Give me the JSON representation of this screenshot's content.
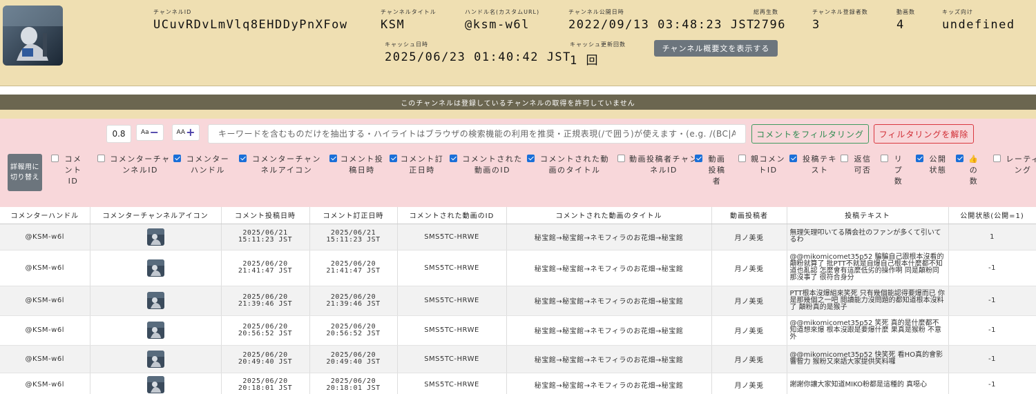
{
  "channel": {
    "avatar_icon": "channel-avatar-icon",
    "id_label": "チャンネルID",
    "id_value": "UCuvRDvLmVlq8EHDDyPnXFow",
    "title_label": "チャンネルタイトル",
    "title_value": "KSM",
    "handle_label": "ハンドル名(カスタムURL)",
    "handle_value": "@ksm-w6l",
    "published_label": "チャンネル公開日時",
    "published_value": "2022/09/13 03:48:23 JST",
    "views_label": "総再生数",
    "views_value": "2796",
    "subs_label": "チャンネル登録者数",
    "subs_value": "3",
    "videos_label": "動画数",
    "videos_value": "4",
    "kids_label": "キッズ向け",
    "kids_value": "undefined",
    "cache_label": "キャッシュ日時",
    "cache_value": "2025/06/23 01:40:42 JST",
    "cache_updates_label": "キャッシュ更新回数",
    "cache_updates_value": "1 回",
    "show_desc_button": "チャンネル概要文を表示する"
  },
  "notice": "このチャンネルは登録しているチャンネルの取得を許可していません",
  "filter": {
    "font_scale": "0.8",
    "decrease_label": "Aa",
    "increase_label": "AA",
    "search_placeholder": "キーワードを含むものだけを抽出する・ハイライトはブラウザの検索機能の利用を推奨・正規表現(/で囲う)が使えます・(e.g. /(BC|AC",
    "filter_button": "コメントをフィルタリング",
    "clear_button": "フィルタリングを解除",
    "switch_button": "詳報用に切り替え"
  },
  "columns": [
    {
      "label": "コメントID",
      "checked": false
    },
    {
      "label": "コメンターチャンネルID",
      "checked": false
    },
    {
      "label": "コメンターハンドル",
      "checked": true
    },
    {
      "label": "コメンターチャンネルアイコン",
      "checked": true
    },
    {
      "label": "コメント投稿日時",
      "checked": true
    },
    {
      "label": "コメント訂正日時",
      "checked": true
    },
    {
      "label": "コメントされた動画のID",
      "checked": true
    },
    {
      "label": "コメントされた動画のタイトル",
      "checked": true
    },
    {
      "label": "動画投稿者チャンネルID",
      "checked": false
    },
    {
      "label": "動画投稿者",
      "checked": true
    },
    {
      "label": "親コメントID",
      "checked": false
    },
    {
      "label": "投稿テキスト",
      "checked": true
    },
    {
      "label": "返信可否",
      "checked": false
    },
    {
      "label": "リプ数",
      "checked": false
    },
    {
      "label": "公開状態",
      "checked": true
    },
    {
      "label": "👍の数",
      "checked": true
    },
    {
      "label": "レーティング",
      "checked": false
    }
  ],
  "table": {
    "headers": [
      "コメンターハンドル",
      "コメンターチャンネルアイコン",
      "コメント投稿日時",
      "コメント訂正日時",
      "コメントされた動画のID",
      "コメントされた動画のタイトル",
      "動画投稿者",
      "投稿テキスト",
      "公開状態(公開=1)"
    ],
    "rows": [
      {
        "handle": "@KSM-w6l",
        "posted_date": "2025/06/21",
        "posted_time": "15:11:23 JST",
        "edited_date": "2025/06/21",
        "edited_time": "15:11:23 JST",
        "video_id": "SMS5TC-HRWE",
        "video_title": "秘宝館→秘宝館→ネモフィラのお花畑→秘宝館",
        "uploader": "月ノ美兎",
        "text": "無理矢理叩いてる隣会社のファンが多くて引いてるわ",
        "status": "1"
      },
      {
        "handle": "@KSM-w6l",
        "posted_date": "2025/06/20",
        "posted_time": "21:41:47 JST",
        "edited_date": "2025/06/20",
        "edited_time": "21:41:47 JST",
        "video_id": "SMS5TC-HRWE",
        "video_title": "秘宝館→秘宝館→ネモフィラのお花畑→秘宝館",
        "uploader": "月ノ美兎",
        "text": "@@mikomicomet35p52 騙騙自己跟根本沒看的顛粉就算了 批PTT不就是自爆自己根本什麼都不知道也亂認 怎麼會有這麼低劣的操作啊 同是顛粉同 那沒事了 很符合身分",
        "status": "-1"
      },
      {
        "handle": "@KSM-w6l",
        "posted_date": "2025/06/20",
        "posted_time": "21:39:46 JST",
        "edited_date": "2025/06/20",
        "edited_time": "21:39:46 JST",
        "video_id": "SMS5TC-HRWE",
        "video_title": "秘宝館→秘宝館→ネモフィラのお花畑→秘宝館",
        "uploader": "月ノ美兎",
        "text": "PTT根本沒爆組來笑死 只有幾個能認得要爆而已 你是那幾個之一吧 閱讀能力沒問題的都知道根本沒料了 顛粉真的是猴子",
        "status": "-1"
      },
      {
        "handle": "@KSM-w6l",
        "posted_date": "2025/06/20",
        "posted_time": "20:56:52 JST",
        "edited_date": "2025/06/20",
        "edited_time": "20:56:52 JST",
        "video_id": "SMS5TC-HRWE",
        "video_title": "秘宝館→秘宝館→ネモフィラのお花畑→秘宝館",
        "uploader": "月ノ美兎",
        "text": "@@mikomicomet35p52 笑死 真的是什麼都不知道想來爆 根本沒跟是要爆什麼 果真是猴粉 不意外",
        "status": "-1"
      },
      {
        "handle": "@KSM-w6l",
        "posted_date": "2025/06/20",
        "posted_time": "20:49:40 JST",
        "edited_date": "2025/06/20",
        "edited_time": "20:49:40 JST",
        "video_id": "SMS5TC-HRWE",
        "video_title": "秘宝館→秘宝館→ネモフィラのお花畑→秘宝館",
        "uploader": "月ノ美兎",
        "text": "@@mikomicomet35p52 快笑死 看HO真的會影響智力 猴粉又來語大家提供笑料囉",
        "status": "-1"
      },
      {
        "handle": "@KSM-w6l",
        "posted_date": "2025/06/20",
        "posted_time": "20:18:01 JST",
        "edited_date": "2025/06/20",
        "edited_time": "20:18:01 JST",
        "video_id": "SMS5TC-HRWE",
        "video_title": "秘宝館→秘宝館→ネモフィラのお花畑→秘宝館",
        "uploader": "月ノ美兎",
        "text": "謝謝你讓大家知道MIKO粉都是這種的 真噁心",
        "status": "-1"
      }
    ]
  }
}
